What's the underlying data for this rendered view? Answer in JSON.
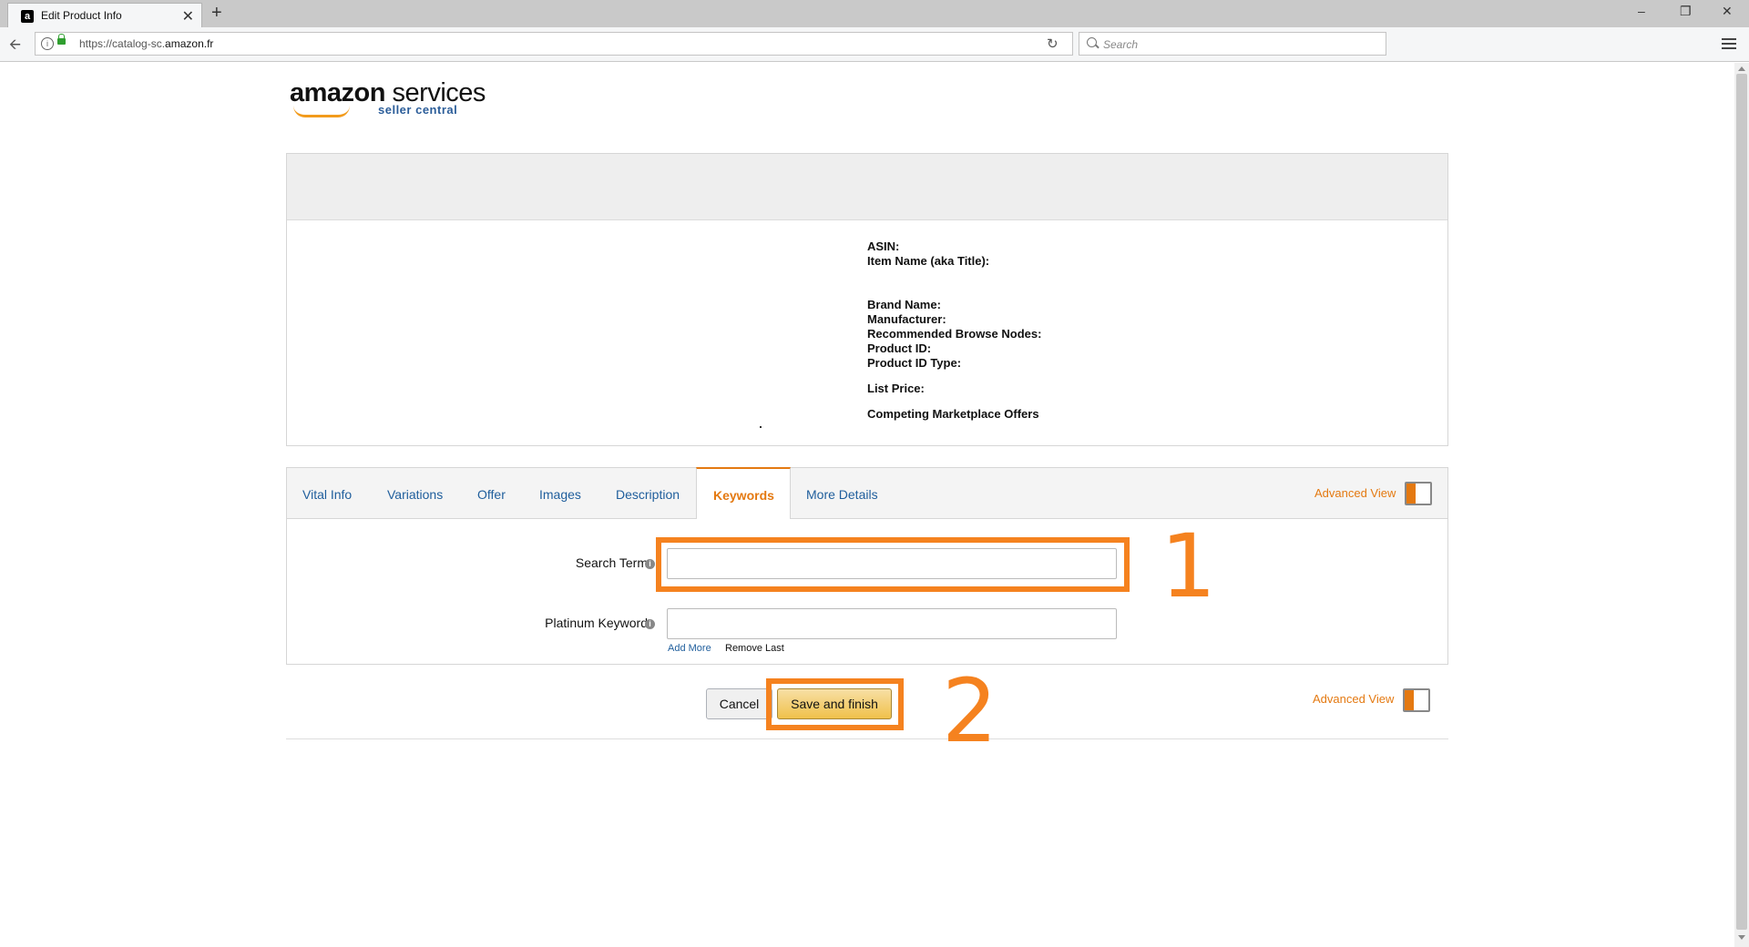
{
  "browser": {
    "tab_title": "Edit Product Info",
    "url_prefix": "https://catalog-sc.",
    "url_domain": "amazon.fr",
    "search_placeholder": "Search",
    "new_tab": "+",
    "close": "✕",
    "window_min": "–",
    "window_restore": "❐",
    "window_close": "✕"
  },
  "logo": {
    "brand": "amazon",
    "services": " services",
    "sub": "seller central"
  },
  "product": {
    "labels": [
      "ASIN:",
      "Item Name (aka Title):",
      "Brand Name:",
      "Manufacturer:",
      "Recommended Browse Nodes:",
      "Product ID:",
      "Product ID Type:",
      "List Price:",
      "Competing Marketplace Offers"
    ]
  },
  "tabs": {
    "items": [
      "Vital Info",
      "Variations",
      "Offer",
      "Images",
      "Description",
      "Keywords",
      "More Details"
    ],
    "active": "Keywords",
    "advanced_view": "Advanced View"
  },
  "form": {
    "search_terms_label": "Search Terms",
    "search_terms_value": "",
    "platinum_label": "Platinum Keywords",
    "platinum_value": "",
    "add_more": "Add More",
    "remove_last": "Remove Last",
    "help_glyph": "i"
  },
  "actions": {
    "cancel": "Cancel",
    "save": "Save and finish",
    "advanced_view": "Advanced View"
  },
  "annotations": {
    "step1": "1",
    "step2": "2",
    "color": "#f5821f"
  },
  "colors": {
    "accent": "#e47911",
    "link": "#1f5e9c",
    "save_button": "#f0c14b"
  }
}
